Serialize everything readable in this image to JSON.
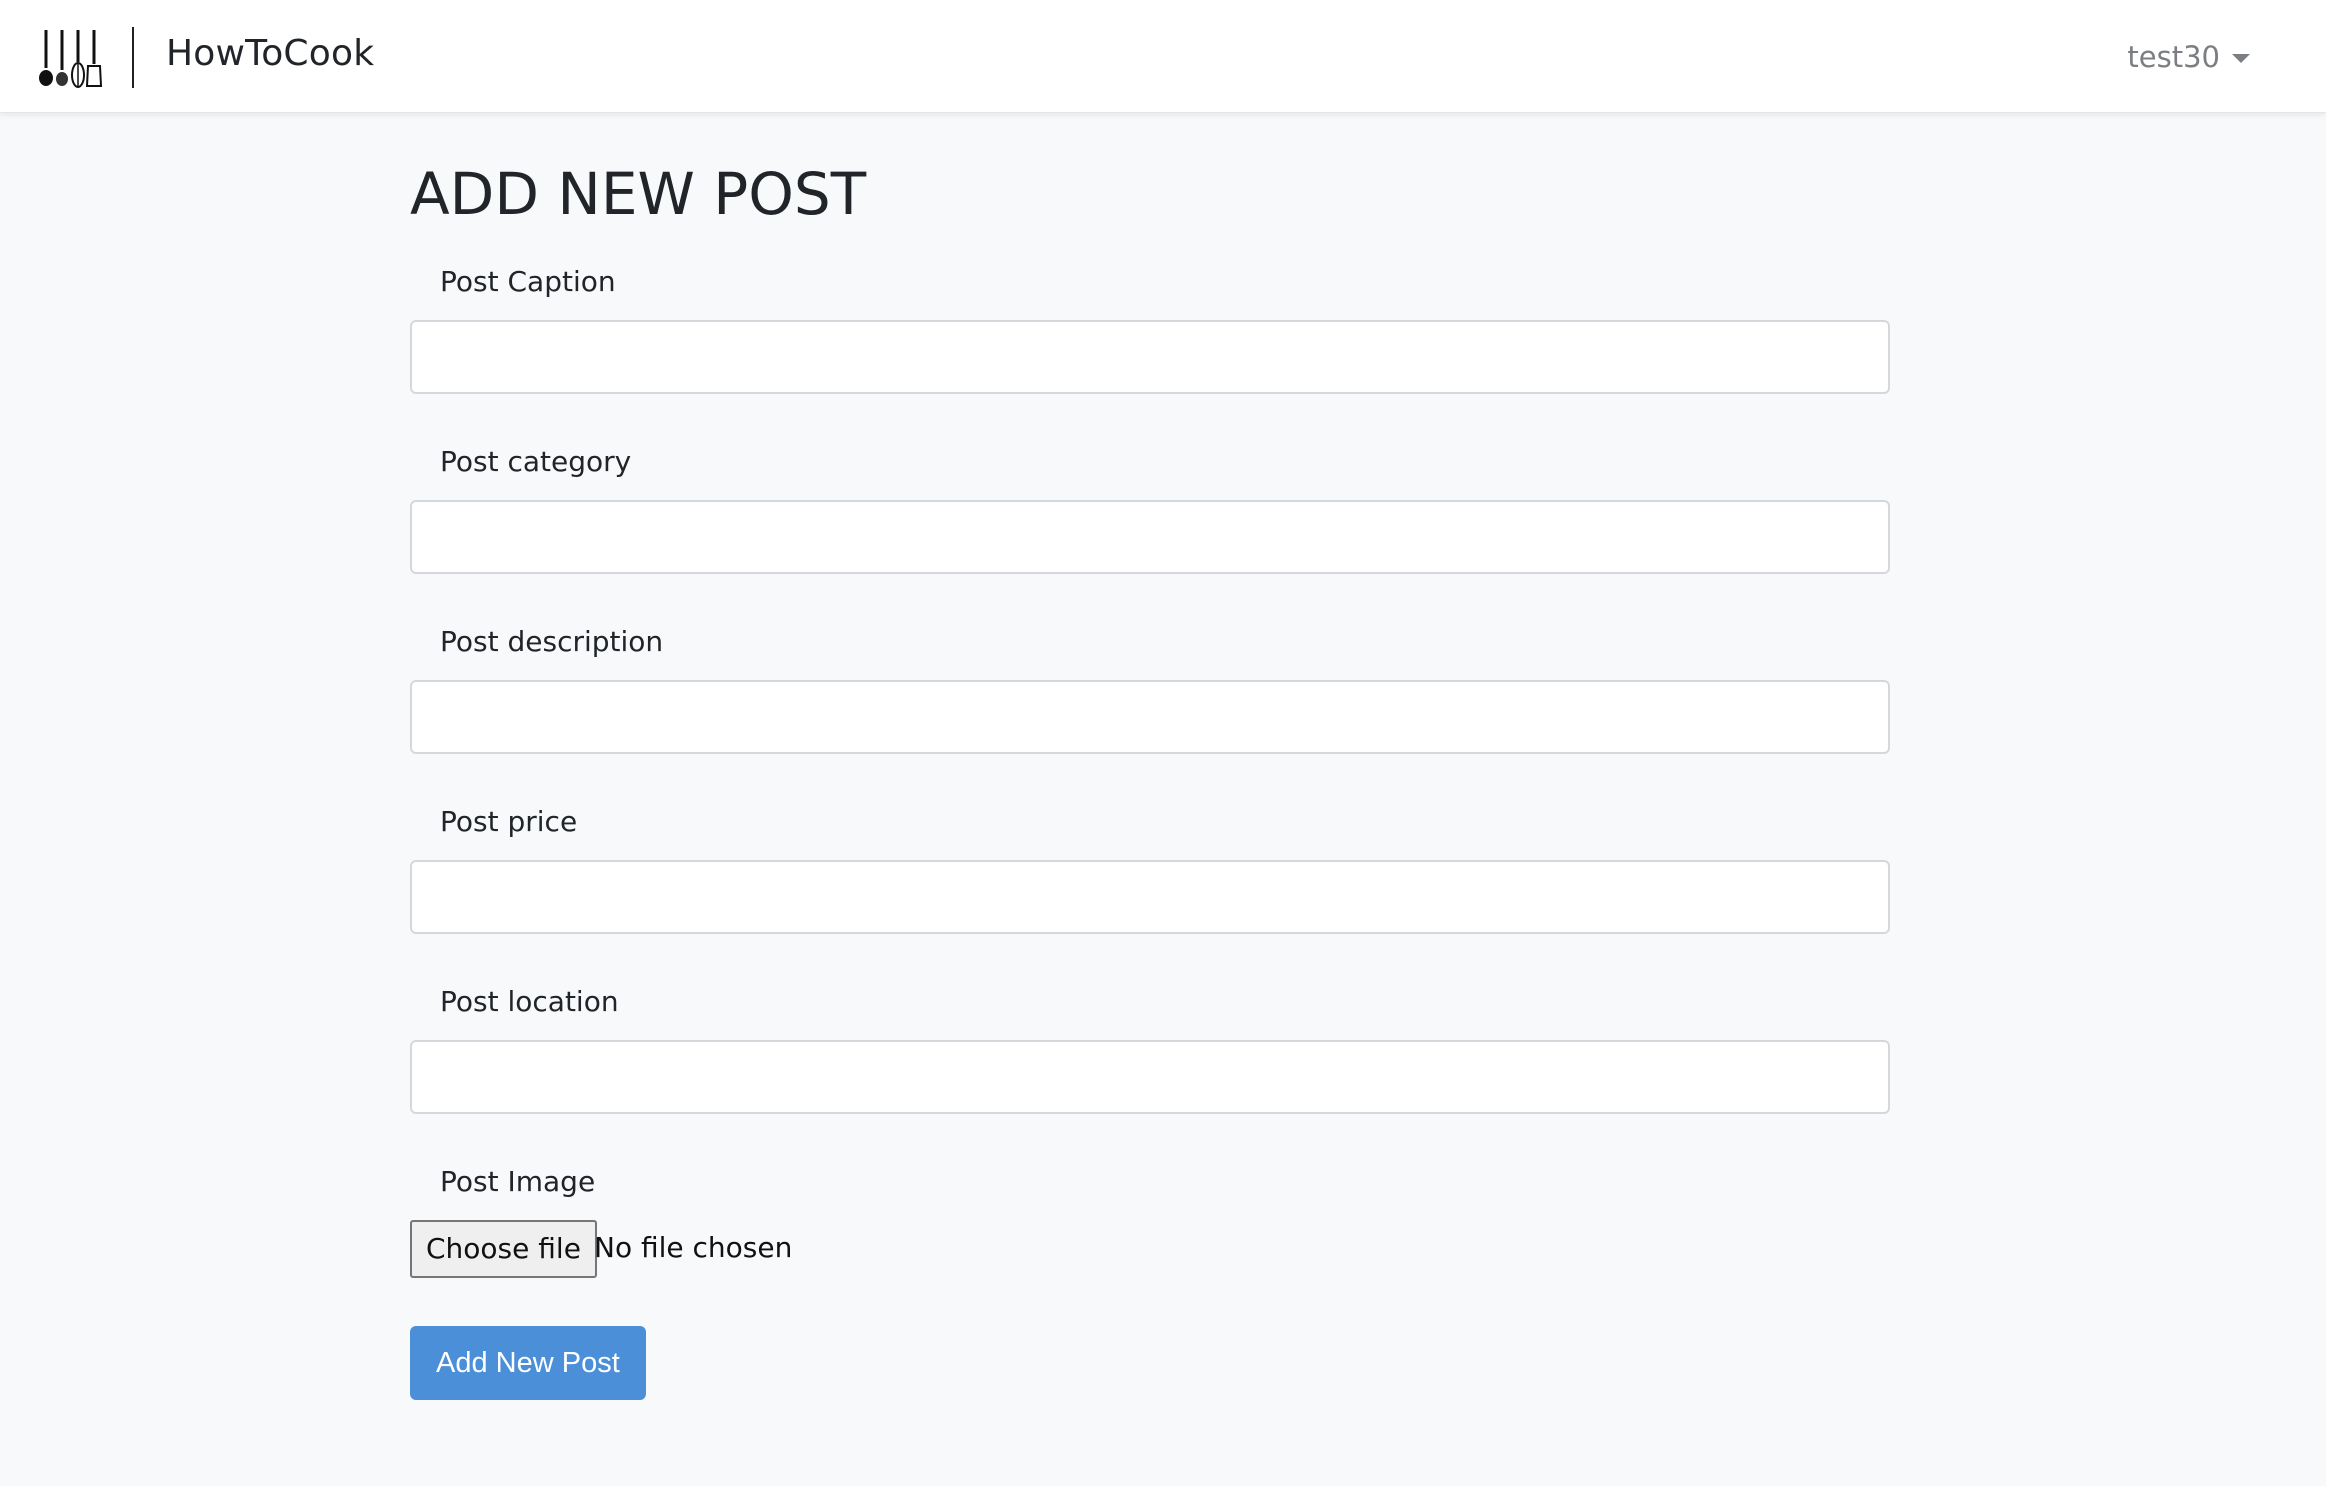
{
  "navbar": {
    "brand": "HowToCook",
    "logo_icon": "kitchen-utensils-icon",
    "user": "test30"
  },
  "page": {
    "title": "ADD NEW POST"
  },
  "form": {
    "caption": {
      "label": "Post Caption",
      "value": "",
      "placeholder": ""
    },
    "category": {
      "label": "Post category",
      "value": "",
      "placeholder": ""
    },
    "description": {
      "label": "Post description",
      "value": "",
      "placeholder": ""
    },
    "price": {
      "label": "Post price",
      "value": "",
      "placeholder": ""
    },
    "location": {
      "label": "Post location",
      "value": "",
      "placeholder": ""
    },
    "image": {
      "label": "Post Image",
      "button_label": "Choose file",
      "status": "No file chosen"
    },
    "submit_label": "Add New Post"
  },
  "colors": {
    "primary": "#4a8fd8",
    "background": "#f8f9fb",
    "navbar": "#ffffff"
  }
}
